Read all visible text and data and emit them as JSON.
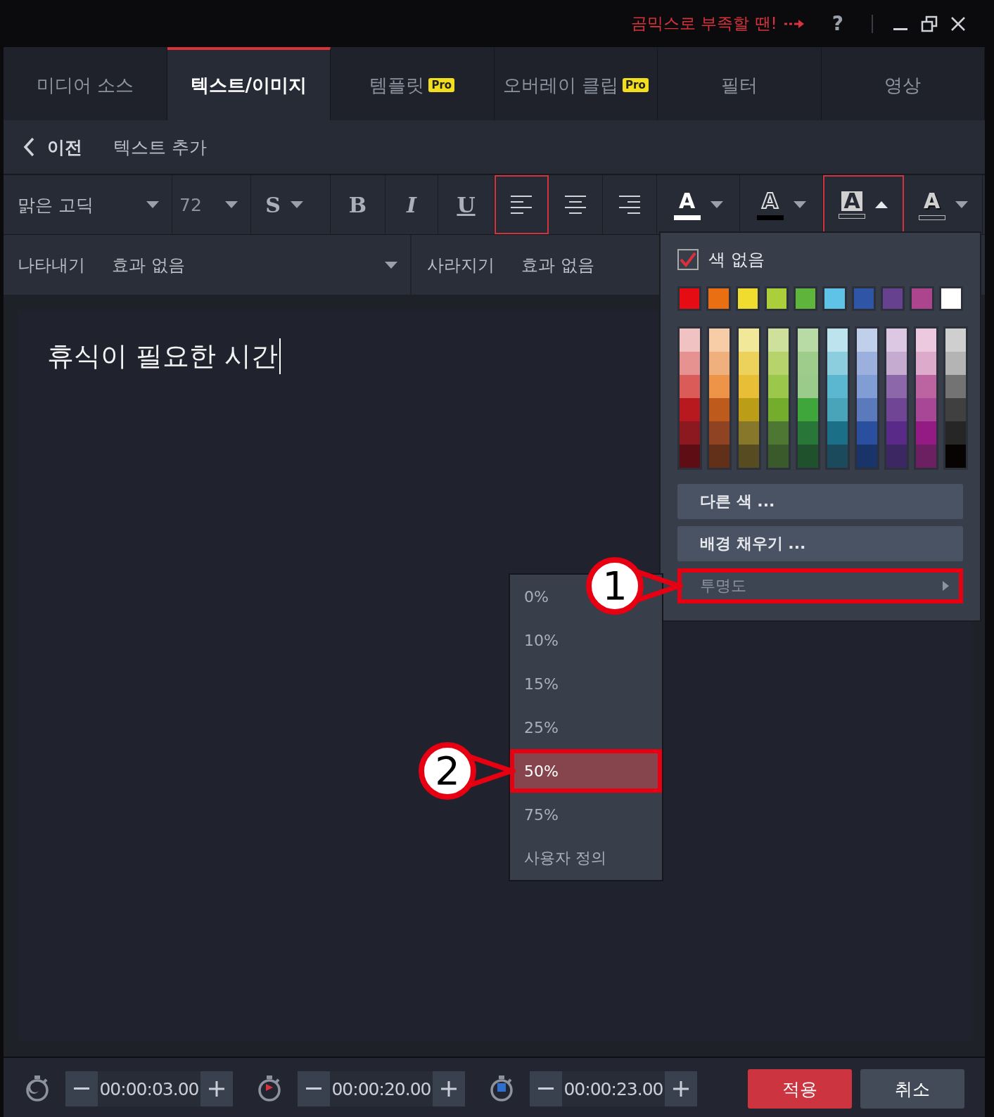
{
  "title_bar": {
    "promo": "곰믹스로 부족할 땐!",
    "help": "?"
  },
  "tabs": [
    {
      "label": "미디어 소스",
      "selected": false
    },
    {
      "label": "텍스트/이미지",
      "selected": true
    },
    {
      "label": "템플릿",
      "badge": "Pro",
      "selected": false
    },
    {
      "label": "오버레이 클립",
      "badge": "Pro",
      "selected": false
    },
    {
      "label": "필터",
      "selected": false
    },
    {
      "label": "영상",
      "selected": false
    }
  ],
  "breadcrumb": {
    "back": "이전",
    "title": "텍스트 추가"
  },
  "toolbar": {
    "font": "맑은 고딕",
    "size": "72",
    "style_buttons": [
      {
        "label": "S",
        "kind": "shadow"
      },
      {
        "label": "B",
        "kind": "bold"
      },
      {
        "label": "I",
        "kind": "italic"
      },
      {
        "label": "U",
        "kind": "underline"
      }
    ],
    "align_buttons": [
      {
        "kind": "left",
        "selected": true
      },
      {
        "kind": "center",
        "selected": false
      },
      {
        "kind": "right",
        "selected": false
      }
    ],
    "color_buttons": [
      {
        "label": "A",
        "kind": "fill",
        "color": "#ffffff",
        "selected": false,
        "expanded": false
      },
      {
        "label": "A",
        "kind": "outline",
        "color": "#000000",
        "selected": false,
        "expanded": false
      },
      {
        "label": "A",
        "kind": "background",
        "selected": true,
        "expanded": true
      },
      {
        "label": "A",
        "kind": "shadow",
        "selected": false,
        "expanded": false
      }
    ]
  },
  "effects": {
    "in_label": "나타내기",
    "in_value": "효과 없음",
    "out_label": "사라지기",
    "out_value": "효과 없음"
  },
  "editor": {
    "text": "휴식이 필요한 시간"
  },
  "color_popup": {
    "no_color": {
      "label": "색 없음",
      "checked": true
    },
    "basic_colors": [
      {
        "color": "#e50c14"
      },
      {
        "color": "#ea6e12"
      },
      {
        "color": "#f0dc2e"
      },
      {
        "color": "#aacf3a"
      },
      {
        "color": "#5fb43c"
      },
      {
        "color": "#5ec3e6"
      },
      {
        "color": "#2f56a6"
      },
      {
        "color": "#65418f"
      },
      {
        "color": "#ad448e"
      },
      {
        "color": "#ffffff"
      }
    ],
    "shade_columns": [
      [
        {
          "color": "#f0c2c1"
        },
        {
          "color": "#e59291"
        },
        {
          "color": "#db5b59"
        },
        {
          "color": "#b8191f"
        },
        {
          "color": "#8c1820"
        },
        {
          "color": "#5f0d14"
        }
      ],
      [
        {
          "color": "#f6cda7"
        },
        {
          "color": "#f0b07d"
        },
        {
          "color": "#ee9449"
        },
        {
          "color": "#bd5a1c"
        },
        {
          "color": "#8f4322"
        },
        {
          "color": "#623018"
        }
      ],
      [
        {
          "color": "#f1e89a"
        },
        {
          "color": "#ecd25a"
        },
        {
          "color": "#e8be36"
        },
        {
          "color": "#bb9d18"
        },
        {
          "color": "#86772a"
        },
        {
          "color": "#574b22"
        }
      ],
      [
        {
          "color": "#cde09c"
        },
        {
          "color": "#b7d46c"
        },
        {
          "color": "#9bc74a"
        },
        {
          "color": "#74ad2b"
        },
        {
          "color": "#4e7734"
        },
        {
          "color": "#3b5a2b"
        }
      ],
      [
        {
          "color": "#b8dba6"
        },
        {
          "color": "#9dcc8b"
        },
        {
          "color": "#9bcb8b"
        },
        {
          "color": "#3fa63b"
        },
        {
          "color": "#287638"
        },
        {
          "color": "#1f512c"
        }
      ],
      [
        {
          "color": "#bde3ee"
        },
        {
          "color": "#8ccedd"
        },
        {
          "color": "#5bb6d0"
        },
        {
          "color": "#4aa4b9"
        },
        {
          "color": "#1b6f86"
        },
        {
          "color": "#1a4a5b"
        }
      ],
      [
        {
          "color": "#c0d0eb"
        },
        {
          "color": "#9bb0dc"
        },
        {
          "color": "#809ed3"
        },
        {
          "color": "#5a7abb"
        },
        {
          "color": "#2a4f9f"
        },
        {
          "color": "#193469"
        }
      ],
      [
        {
          "color": "#dcc8e2"
        },
        {
          "color": "#c6abd1"
        },
        {
          "color": "#8c67aa"
        },
        {
          "color": "#704595"
        },
        {
          "color": "#5a2a88"
        },
        {
          "color": "#3d2763"
        }
      ],
      [
        {
          "color": "#ecc9df"
        },
        {
          "color": "#ddaacb"
        },
        {
          "color": "#bb64a1"
        },
        {
          "color": "#a84795"
        },
        {
          "color": "#941b84"
        },
        {
          "color": "#6c2061"
        }
      ],
      [
        {
          "color": "#cfcfcf"
        },
        {
          "color": "#b4b4b4"
        },
        {
          "color": "#737373"
        },
        {
          "color": "#404040"
        },
        {
          "color": "#262626"
        },
        {
          "color": "#070303"
        }
      ]
    ],
    "menu_items": [
      {
        "label": "다른 색 ...",
        "kind": "action"
      },
      {
        "label": "배경 채우기 ...",
        "kind": "action"
      },
      {
        "label": "투명도",
        "kind": "submenu",
        "callout": "1"
      }
    ]
  },
  "opacity_menu": {
    "items": [
      {
        "label": "0%",
        "selected": false
      },
      {
        "label": "10%",
        "selected": false
      },
      {
        "label": "15%",
        "selected": false
      },
      {
        "label": "25%",
        "selected": false
      },
      {
        "label": "50%",
        "selected": true,
        "callout": "2"
      },
      {
        "label": "75%",
        "selected": false
      },
      {
        "label": "사용자 정의",
        "selected": false
      }
    ]
  },
  "bottom_bar": {
    "timers": [
      {
        "kind": "start",
        "value": "00:00:03.00"
      },
      {
        "kind": "play",
        "value": "00:00:20.00"
      },
      {
        "kind": "stop",
        "value": "00:00:23.00"
      }
    ],
    "buttons": [
      {
        "label": "적용",
        "kind": "primary"
      },
      {
        "label": "취소",
        "kind": "secondary"
      }
    ]
  }
}
